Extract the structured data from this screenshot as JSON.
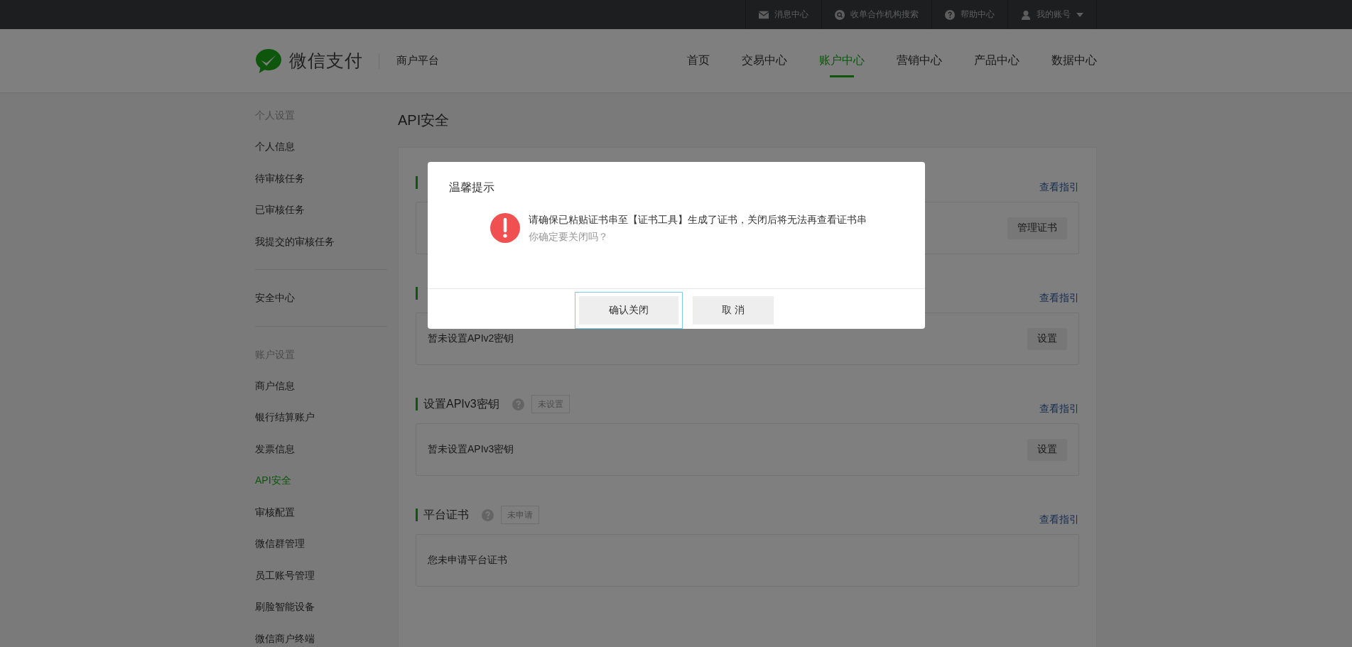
{
  "top_bar": {
    "links": [
      {
        "kind": "mail",
        "label": "消息中心"
      },
      {
        "kind": "search",
        "label": "收单合作机构搜索"
      },
      {
        "kind": "help",
        "label": "帮助中心"
      },
      {
        "kind": "account",
        "label": "我的账号"
      }
    ]
  },
  "header": {
    "logo": "微信支付",
    "subtitle": "商户平台",
    "nav": [
      {
        "label": "首页",
        "selected": false
      },
      {
        "label": "交易中心",
        "selected": false
      },
      {
        "label": "账户中心",
        "selected": true
      },
      {
        "label": "营销中心",
        "selected": false
      },
      {
        "label": "产品中心",
        "selected": false
      },
      {
        "label": "数据中心",
        "selected": false
      }
    ]
  },
  "sidebar": {
    "groups": [
      {
        "heading": "个人设置",
        "items": [
          {
            "label": "个人信息",
            "selected": false
          },
          {
            "label": "待审核任务",
            "selected": false
          },
          {
            "label": "已审核任务",
            "selected": false
          },
          {
            "label": "我提交的审核任务",
            "selected": false
          }
        ]
      },
      {
        "items": [
          {
            "label": "安全中心",
            "selected": false
          }
        ]
      },
      {
        "heading": "账户设置",
        "items": [
          {
            "label": "商户信息",
            "selected": false
          },
          {
            "label": "银行结算账户",
            "selected": false
          },
          {
            "label": "发票信息",
            "selected": false
          },
          {
            "label": "API安全",
            "selected": true
          },
          {
            "label": "审核配置",
            "selected": false
          },
          {
            "label": "微信群管理",
            "selected": false
          },
          {
            "label": "员工账号管理",
            "selected": false
          },
          {
            "label": "刷脸智能设备",
            "selected": false
          },
          {
            "label": "微信商户终端",
            "selected": false
          }
        ]
      }
    ]
  },
  "page_title": "API安全",
  "sections": [
    {
      "help_icon": false,
      "guide_link": "查看指引",
      "button": "管理证书"
    },
    {
      "help_icon": false,
      "guide_link": "查看指引",
      "body": "暂未设置APIv2密钥",
      "button": "设置"
    },
    {
      "title": "设置APIv3密钥",
      "help_icon": true,
      "badge": "未设置",
      "guide_link": "查看指引",
      "body": "暂未设置APIv3密钥",
      "button": "设置"
    },
    {
      "title": "平台证书",
      "help_icon": true,
      "badge": "未申请",
      "guide_link": "查看指引",
      "body": "您未申请平台证书"
    }
  ],
  "dialog": {
    "title": "温馨提示",
    "message": "请确保已粘贴证书串至【证书工具】生成了证书，关闭后将无法再查看证书串",
    "note": "你确定要关闭吗？",
    "buttons": [
      {
        "label": "确认关闭",
        "focused": true
      },
      {
        "label": "取 消",
        "focused": false
      }
    ]
  }
}
